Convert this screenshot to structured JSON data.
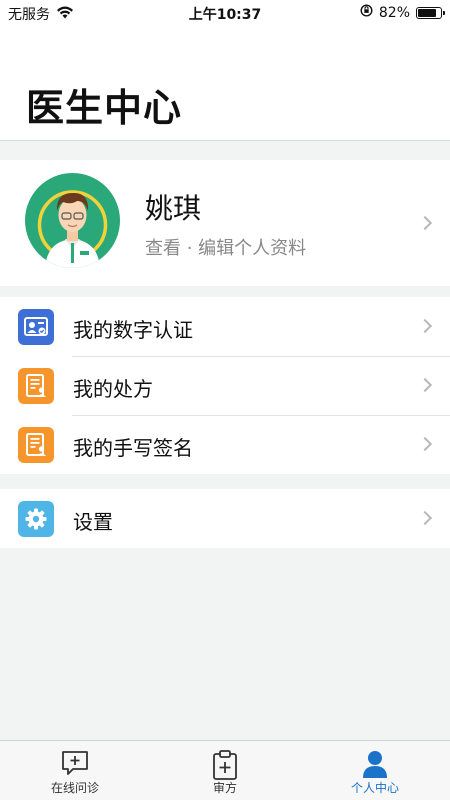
{
  "status_bar": {
    "carrier": "无服务",
    "time": "上午10:37",
    "battery_text": "82%",
    "battery_level": 0.82
  },
  "header": {
    "title": "医生中心"
  },
  "profile": {
    "name": "姚琪",
    "subtitle": "查看 · 编辑个人资料"
  },
  "menu": {
    "items": [
      {
        "label": "我的数字认证",
        "icon": "id-card-icon",
        "color": "#3d6fd6"
      },
      {
        "label": "我的处方",
        "icon": "prescription-icon",
        "color": "#f6952b"
      },
      {
        "label": "我的手写签名",
        "icon": "signature-doc-icon",
        "color": "#f6952b"
      }
    ],
    "settings": {
      "label": "设置",
      "icon": "gear-icon",
      "color": "#4fb4e6"
    }
  },
  "tabbar": {
    "tabs": [
      {
        "label": "在线问诊",
        "icon": "chat-plus-icon",
        "active": false
      },
      {
        "label": "审方",
        "icon": "clipboard-plus-icon",
        "active": false
      },
      {
        "label": "个人中心",
        "icon": "person-icon",
        "active": true
      }
    ],
    "active_color": "#1a73c9"
  }
}
